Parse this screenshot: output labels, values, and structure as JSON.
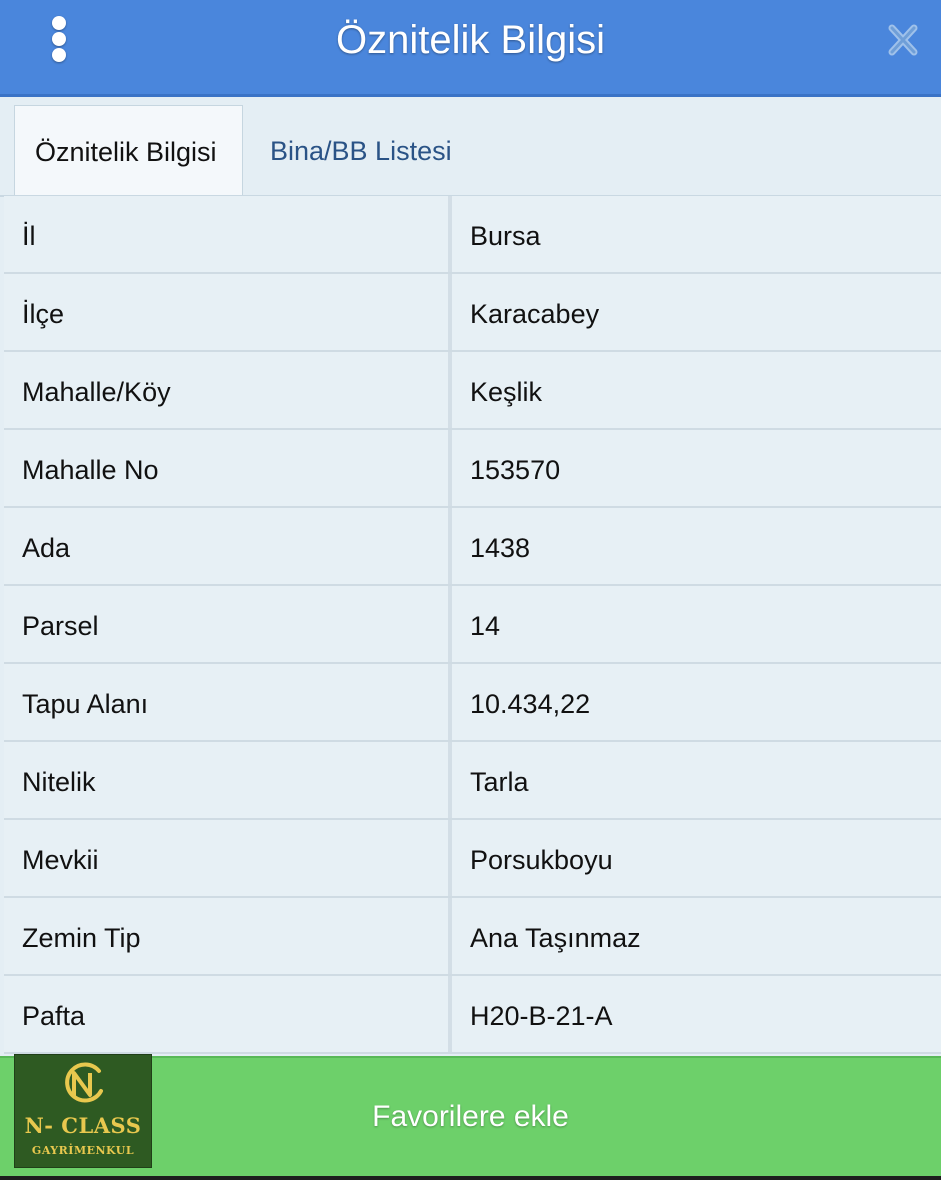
{
  "header": {
    "title": "Öznitelik Bilgisi",
    "menu_icon": "more-vertical-icon",
    "close_icon": "close-icon"
  },
  "tabs": [
    {
      "label": "Öznitelik Bilgisi",
      "active": true
    },
    {
      "label": "Bina/BB Listesi",
      "active": false
    }
  ],
  "attributes": [
    {
      "key": "İl",
      "value": "Bursa"
    },
    {
      "key": "İlçe",
      "value": "Karacabey"
    },
    {
      "key": "Mahalle/Köy",
      "value": "Keşlik"
    },
    {
      "key": "Mahalle No",
      "value": "153570"
    },
    {
      "key": "Ada",
      "value": "1438"
    },
    {
      "key": "Parsel",
      "value": "14"
    },
    {
      "key": "Tapu Alanı",
      "value": "10.434,22"
    },
    {
      "key": "Nitelik",
      "value": "Tarla"
    },
    {
      "key": "Mevkii",
      "value": "Porsukboyu"
    },
    {
      "key": "Zemin Tip",
      "value": "Ana Taşınmaz"
    },
    {
      "key": "Pafta",
      "value": "H20-B-21-A"
    }
  ],
  "footer": {
    "button_label": "Favorilere ekle"
  },
  "logo": {
    "name": "N- CLASS",
    "subtitle": "GAYRİMENKUL"
  },
  "colors": {
    "header": "#4a86dc",
    "footer": "#6dd06a",
    "logo_bg": "#2e5a22",
    "logo_gold": "#e8c84e"
  }
}
